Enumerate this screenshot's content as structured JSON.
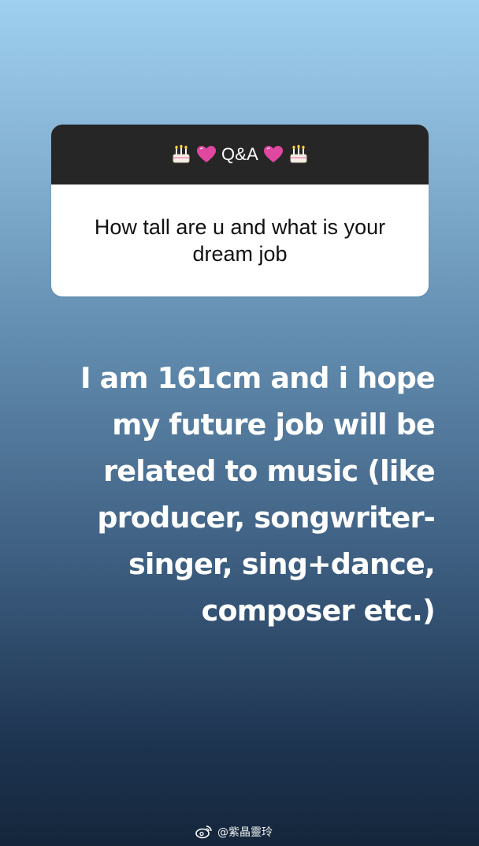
{
  "qa_card": {
    "title": "Q&A",
    "header_icons": [
      "cake-icon",
      "heart-icon",
      "heart-icon",
      "cake-icon"
    ],
    "question": "How tall are u and what is your dream job"
  },
  "answer": {
    "text": "I am 161cm and i hope my future job will be related to music (like producer, songwriter-singer, sing+dance, composer etc.)"
  },
  "watermark": {
    "icon": "weibo-icon",
    "text": "@紫晶靈玲"
  },
  "colors": {
    "gradient_top": "#9fd0f0",
    "gradient_bottom": "#15263b",
    "card_header": "#262626",
    "card_body": "#ffffff",
    "heart": "#e0479f"
  }
}
